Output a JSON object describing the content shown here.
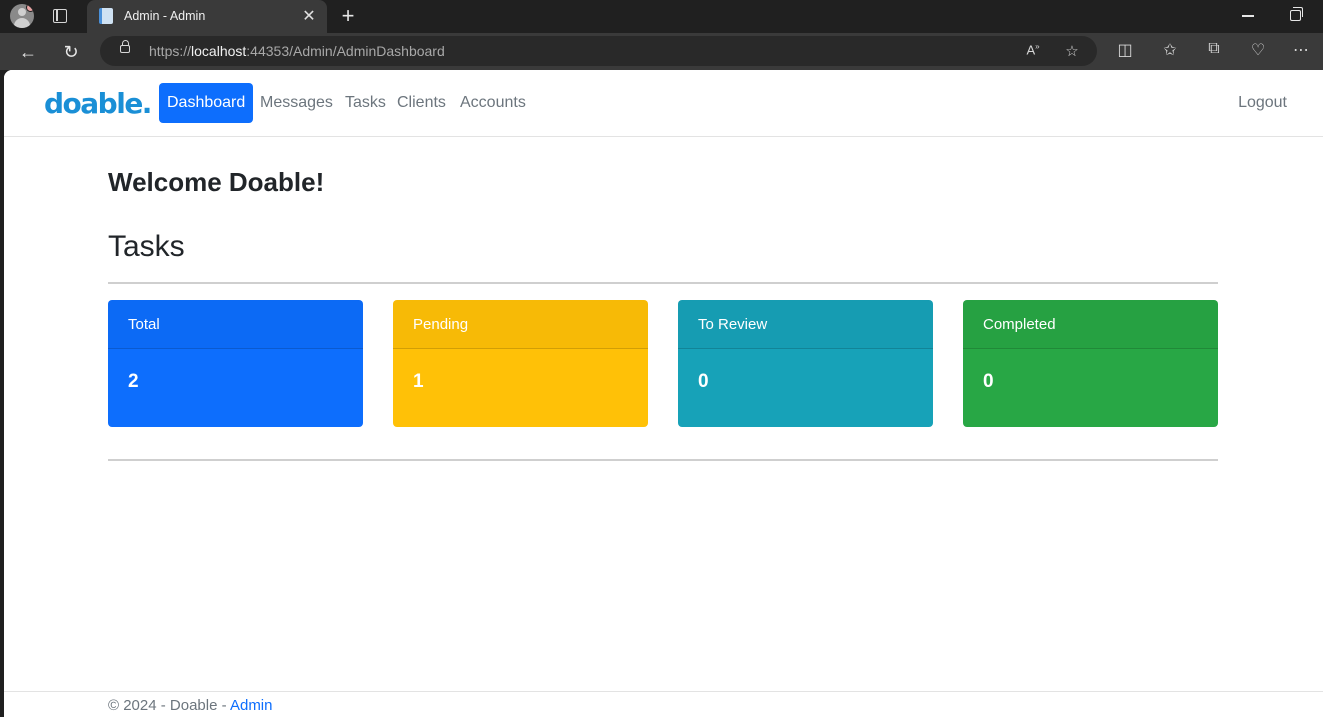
{
  "browser": {
    "tab_title": "Admin - Admin",
    "tab_close": "✕",
    "new_tab": "+",
    "url_scheme": "https://",
    "url_host": "localhost",
    "url_rest": ":44353/Admin/AdminDashboard"
  },
  "app": {
    "brand": "doable.",
    "nav": {
      "dashboard": "Dashboard",
      "messages": "Messages",
      "tasks": "Tasks",
      "clients": "Clients",
      "accounts": "Accounts",
      "logout": "Logout"
    },
    "welcome": "Welcome Doable!",
    "section_title": "Tasks",
    "cards": [
      {
        "label": "Total",
        "value": "2",
        "color": "#0d6efd"
      },
      {
        "label": "Pending",
        "value": "1",
        "color": "#ffc107"
      },
      {
        "label": "To Review",
        "value": "0",
        "color": "#17a2b8"
      },
      {
        "label": "Completed",
        "value": "0",
        "color": "#28a745"
      }
    ],
    "footer": {
      "text": "© 2024 - Doable - ",
      "link": "Admin"
    }
  }
}
